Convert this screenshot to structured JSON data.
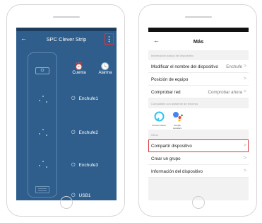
{
  "left": {
    "back_icon": "arrow-left-icon",
    "title": "SPC Clever Strip",
    "menu_icon": "kebab-menu-icon",
    "actions": [
      {
        "label": "Cuenta",
        "icon": "alarm-clock-icon"
      },
      {
        "label": "Alarma",
        "icon": "clock-icon"
      }
    ],
    "power_glyph": "⏻",
    "plugs": [
      {
        "label": "Enchufe1"
      },
      {
        "label": "Enchufe2"
      },
      {
        "label": "Enchufe3"
      },
      {
        "label": "USB1"
      }
    ],
    "colors": {
      "background": "#2f5e8c",
      "highlight": "#d9363e"
    }
  },
  "right": {
    "back_icon": "arrow-left-icon",
    "title": "Más",
    "sections": {
      "info": "Información básica del dispositivo",
      "compat": "Compatible con asistente de terceros",
      "other": "Otros"
    },
    "rows": {
      "rename": {
        "label": "Modificar el nombre del dispositivo",
        "value": "Enchufe"
      },
      "location": {
        "label": "Posición de equipo"
      },
      "network": {
        "label": "Comprobar red",
        "value": "Comprobar ahora"
      },
      "share": {
        "label": "Compartir dispositivo"
      },
      "group": {
        "label": "Crear un grupo"
      },
      "device_info": {
        "label": "Información del dispositivo"
      }
    },
    "assistants": [
      {
        "name": "Amazon Alexa",
        "icon": "alexa-icon"
      },
      {
        "name": "Google Assistant",
        "icon": "google-assistant-icon"
      }
    ],
    "chevron": ">",
    "colors": {
      "highlight": "#d9363e"
    }
  }
}
